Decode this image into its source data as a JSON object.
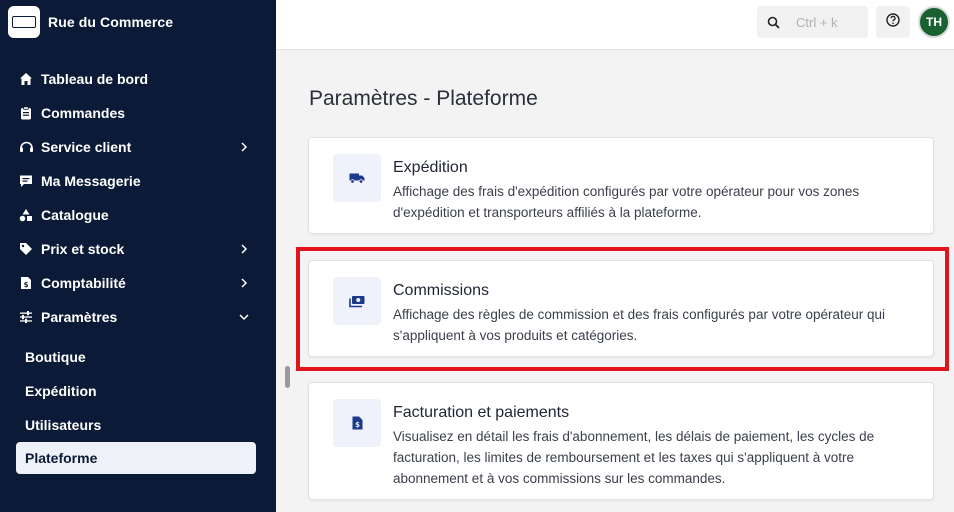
{
  "brand": {
    "name": "Rue du Commerce"
  },
  "nav": {
    "items": [
      {
        "label": "Tableau de bord",
        "icon": "home-icon"
      },
      {
        "label": "Commandes",
        "icon": "clipboard-icon"
      },
      {
        "label": "Service client",
        "icon": "headset-icon",
        "expandable": true
      },
      {
        "label": "Ma Messagerie",
        "icon": "message-icon"
      },
      {
        "label": "Catalogue",
        "icon": "shapes-icon"
      },
      {
        "label": "Prix et stock",
        "icon": "tag-icon",
        "expandable": true
      },
      {
        "label": "Comptabilité",
        "icon": "invoice-icon",
        "expandable": true
      },
      {
        "label": "Paramètres",
        "icon": "sliders-icon",
        "expanded": true
      }
    ],
    "sub_items": [
      {
        "label": "Boutique"
      },
      {
        "label": "Expédition"
      },
      {
        "label": "Utilisateurs"
      },
      {
        "label": "Plateforme",
        "active": true
      }
    ]
  },
  "topbar": {
    "search_placeholder": "Ctrl + k",
    "avatar_initials": "TH"
  },
  "main": {
    "title": "Paramètres - Plateforme",
    "cards": [
      {
        "title": "Expédition",
        "description": "Affichage des frais d'expédition configurés par votre opérateur pour vos zones d'expédition et transporteurs affiliés à la plateforme.",
        "icon": "truck-icon"
      },
      {
        "title": "Commissions",
        "description": "Affichage des règles de commission et des frais configurés par votre opérateur qui s'appliquent à vos produits et catégories.",
        "icon": "money-icon",
        "highlighted": true
      },
      {
        "title": "Facturation et paiements",
        "description": "Visualisez en détail les frais d'abonnement, les délais de paiement, les cycles de facturation, les limites de remboursement et les taxes qui s'appliquent à votre abonnement et à vos commissions sur les commandes.",
        "icon": "invoice-icon"
      }
    ]
  },
  "colors": {
    "sidebar_bg": "#0b1a36",
    "accent": "#1d3a8a",
    "highlight": "#e0141c",
    "avatar_bg": "#1a6132"
  }
}
